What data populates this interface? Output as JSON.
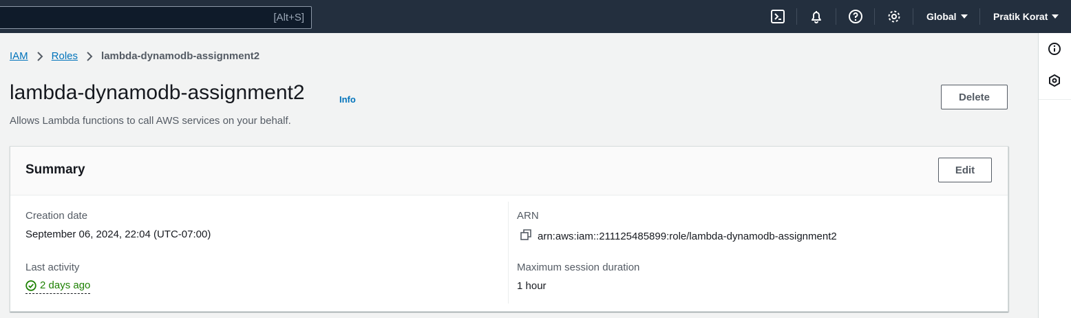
{
  "topnav": {
    "search_shortcut": "[Alt+S]",
    "region_label": "Global",
    "user_label": "Pratik Korat",
    "icons": [
      "cloudshell-icon",
      "notifications-icon",
      "help-icon",
      "settings-icon"
    ]
  },
  "breadcrumb": {
    "items": [
      {
        "label": "IAM"
      },
      {
        "label": "Roles"
      },
      {
        "label": "lambda-dynamodb-assignment2"
      }
    ]
  },
  "header": {
    "title": "lambda-dynamodb-assignment2",
    "info_label": "Info",
    "description": "Allows Lambda functions to call AWS services on your behalf.",
    "delete_label": "Delete"
  },
  "summary": {
    "title": "Summary",
    "edit_label": "Edit",
    "creation_date_label": "Creation date",
    "creation_date_value": "September 06, 2024, 22:04 (UTC-07:00)",
    "last_activity_label": "Last activity",
    "last_activity_value": "2 days ago",
    "arn_label": "ARN",
    "arn_value": "arn:aws:iam::211125485899:role/lambda-dynamodb-assignment2",
    "max_session_label": "Maximum session duration",
    "max_session_value": "1 hour"
  },
  "side_panel": {
    "icons": [
      "info-panel-icon",
      "feedback-panel-icon"
    ]
  },
  "colors": {
    "nav_bg": "#232f3e",
    "link": "#0073bb",
    "success": "#1d8102",
    "page_bg": "#f2f3f3"
  }
}
